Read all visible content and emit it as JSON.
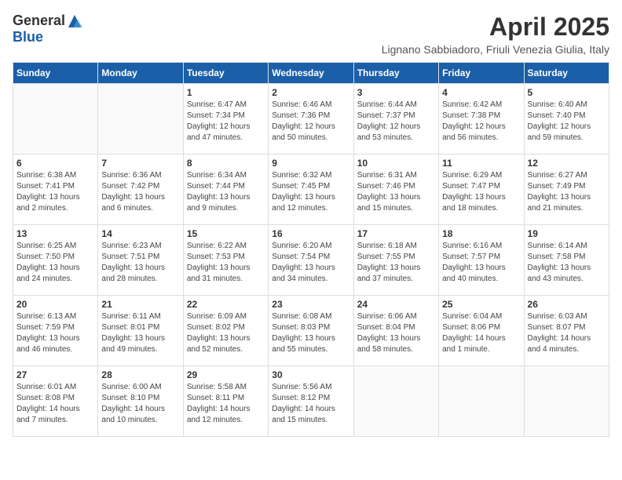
{
  "header": {
    "logo_general": "General",
    "logo_blue": "Blue",
    "month": "April 2025",
    "location": "Lignano Sabbiadoro, Friuli Venezia Giulia, Italy"
  },
  "weekdays": [
    "Sunday",
    "Monday",
    "Tuesday",
    "Wednesday",
    "Thursday",
    "Friday",
    "Saturday"
  ],
  "weeks": [
    [
      {
        "day": "",
        "sunrise": "",
        "sunset": "",
        "daylight": ""
      },
      {
        "day": "",
        "sunrise": "",
        "sunset": "",
        "daylight": ""
      },
      {
        "day": "1",
        "sunrise": "Sunrise: 6:47 AM",
        "sunset": "Sunset: 7:34 PM",
        "daylight": "Daylight: 12 hours and 47 minutes."
      },
      {
        "day": "2",
        "sunrise": "Sunrise: 6:46 AM",
        "sunset": "Sunset: 7:36 PM",
        "daylight": "Daylight: 12 hours and 50 minutes."
      },
      {
        "day": "3",
        "sunrise": "Sunrise: 6:44 AM",
        "sunset": "Sunset: 7:37 PM",
        "daylight": "Daylight: 12 hours and 53 minutes."
      },
      {
        "day": "4",
        "sunrise": "Sunrise: 6:42 AM",
        "sunset": "Sunset: 7:38 PM",
        "daylight": "Daylight: 12 hours and 56 minutes."
      },
      {
        "day": "5",
        "sunrise": "Sunrise: 6:40 AM",
        "sunset": "Sunset: 7:40 PM",
        "daylight": "Daylight: 12 hours and 59 minutes."
      }
    ],
    [
      {
        "day": "6",
        "sunrise": "Sunrise: 6:38 AM",
        "sunset": "Sunset: 7:41 PM",
        "daylight": "Daylight: 13 hours and 2 minutes."
      },
      {
        "day": "7",
        "sunrise": "Sunrise: 6:36 AM",
        "sunset": "Sunset: 7:42 PM",
        "daylight": "Daylight: 13 hours and 6 minutes."
      },
      {
        "day": "8",
        "sunrise": "Sunrise: 6:34 AM",
        "sunset": "Sunset: 7:44 PM",
        "daylight": "Daylight: 13 hours and 9 minutes."
      },
      {
        "day": "9",
        "sunrise": "Sunrise: 6:32 AM",
        "sunset": "Sunset: 7:45 PM",
        "daylight": "Daylight: 13 hours and 12 minutes."
      },
      {
        "day": "10",
        "sunrise": "Sunrise: 6:31 AM",
        "sunset": "Sunset: 7:46 PM",
        "daylight": "Daylight: 13 hours and 15 minutes."
      },
      {
        "day": "11",
        "sunrise": "Sunrise: 6:29 AM",
        "sunset": "Sunset: 7:47 PM",
        "daylight": "Daylight: 13 hours and 18 minutes."
      },
      {
        "day": "12",
        "sunrise": "Sunrise: 6:27 AM",
        "sunset": "Sunset: 7:49 PM",
        "daylight": "Daylight: 13 hours and 21 minutes."
      }
    ],
    [
      {
        "day": "13",
        "sunrise": "Sunrise: 6:25 AM",
        "sunset": "Sunset: 7:50 PM",
        "daylight": "Daylight: 13 hours and 24 minutes."
      },
      {
        "day": "14",
        "sunrise": "Sunrise: 6:23 AM",
        "sunset": "Sunset: 7:51 PM",
        "daylight": "Daylight: 13 hours and 28 minutes."
      },
      {
        "day": "15",
        "sunrise": "Sunrise: 6:22 AM",
        "sunset": "Sunset: 7:53 PM",
        "daylight": "Daylight: 13 hours and 31 minutes."
      },
      {
        "day": "16",
        "sunrise": "Sunrise: 6:20 AM",
        "sunset": "Sunset: 7:54 PM",
        "daylight": "Daylight: 13 hours and 34 minutes."
      },
      {
        "day": "17",
        "sunrise": "Sunrise: 6:18 AM",
        "sunset": "Sunset: 7:55 PM",
        "daylight": "Daylight: 13 hours and 37 minutes."
      },
      {
        "day": "18",
        "sunrise": "Sunrise: 6:16 AM",
        "sunset": "Sunset: 7:57 PM",
        "daylight": "Daylight: 13 hours and 40 minutes."
      },
      {
        "day": "19",
        "sunrise": "Sunrise: 6:14 AM",
        "sunset": "Sunset: 7:58 PM",
        "daylight": "Daylight: 13 hours and 43 minutes."
      }
    ],
    [
      {
        "day": "20",
        "sunrise": "Sunrise: 6:13 AM",
        "sunset": "Sunset: 7:59 PM",
        "daylight": "Daylight: 13 hours and 46 minutes."
      },
      {
        "day": "21",
        "sunrise": "Sunrise: 6:11 AM",
        "sunset": "Sunset: 8:01 PM",
        "daylight": "Daylight: 13 hours and 49 minutes."
      },
      {
        "day": "22",
        "sunrise": "Sunrise: 6:09 AM",
        "sunset": "Sunset: 8:02 PM",
        "daylight": "Daylight: 13 hours and 52 minutes."
      },
      {
        "day": "23",
        "sunrise": "Sunrise: 6:08 AM",
        "sunset": "Sunset: 8:03 PM",
        "daylight": "Daylight: 13 hours and 55 minutes."
      },
      {
        "day": "24",
        "sunrise": "Sunrise: 6:06 AM",
        "sunset": "Sunset: 8:04 PM",
        "daylight": "Daylight: 13 hours and 58 minutes."
      },
      {
        "day": "25",
        "sunrise": "Sunrise: 6:04 AM",
        "sunset": "Sunset: 8:06 PM",
        "daylight": "Daylight: 14 hours and 1 minute."
      },
      {
        "day": "26",
        "sunrise": "Sunrise: 6:03 AM",
        "sunset": "Sunset: 8:07 PM",
        "daylight": "Daylight: 14 hours and 4 minutes."
      }
    ],
    [
      {
        "day": "27",
        "sunrise": "Sunrise: 6:01 AM",
        "sunset": "Sunset: 8:08 PM",
        "daylight": "Daylight: 14 hours and 7 minutes."
      },
      {
        "day": "28",
        "sunrise": "Sunrise: 6:00 AM",
        "sunset": "Sunset: 8:10 PM",
        "daylight": "Daylight: 14 hours and 10 minutes."
      },
      {
        "day": "29",
        "sunrise": "Sunrise: 5:58 AM",
        "sunset": "Sunset: 8:11 PM",
        "daylight": "Daylight: 14 hours and 12 minutes."
      },
      {
        "day": "30",
        "sunrise": "Sunrise: 5:56 AM",
        "sunset": "Sunset: 8:12 PM",
        "daylight": "Daylight: 14 hours and 15 minutes."
      },
      {
        "day": "",
        "sunrise": "",
        "sunset": "",
        "daylight": ""
      },
      {
        "day": "",
        "sunrise": "",
        "sunset": "",
        "daylight": ""
      },
      {
        "day": "",
        "sunrise": "",
        "sunset": "",
        "daylight": ""
      }
    ]
  ]
}
